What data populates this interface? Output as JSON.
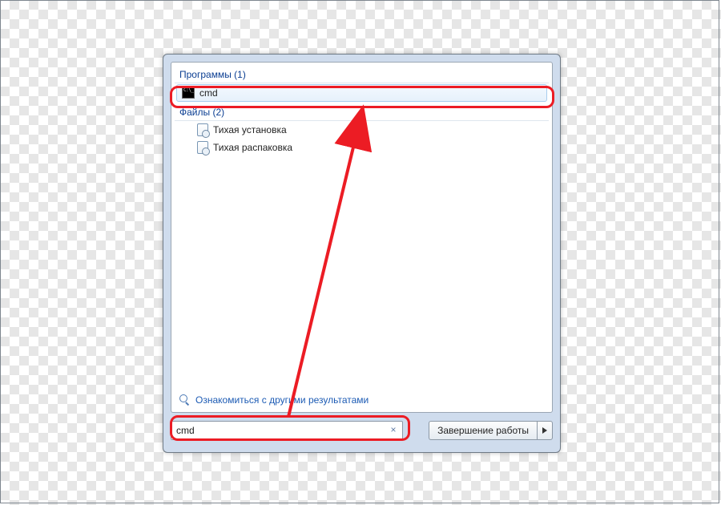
{
  "sections": {
    "programs": {
      "header": "Программы (1)"
    },
    "files": {
      "header": "Файлы (2)"
    }
  },
  "results": {
    "program": "cmd",
    "file1": "Тихая установка",
    "file2": "Тихая распаковка"
  },
  "see_more": "Ознакомиться с другими результатами",
  "search": {
    "value": "cmd",
    "clear_glyph": "×"
  },
  "shutdown": {
    "label": "Завершение работы"
  }
}
